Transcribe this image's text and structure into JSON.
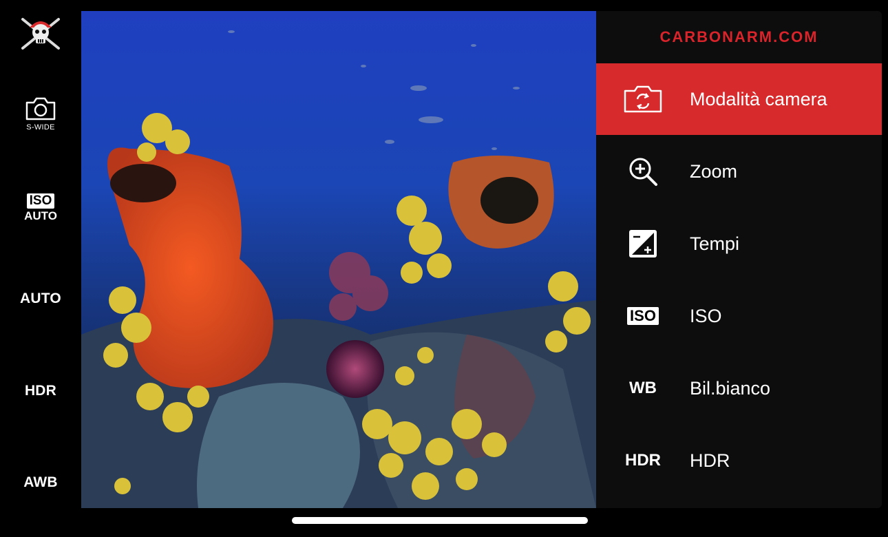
{
  "sidebar": {
    "camera_label": "S-WIDE",
    "iso_box": "ISO",
    "iso_value": "AUTO",
    "exposure": "AUTO",
    "hdr": "HDR",
    "wb": "AWB"
  },
  "menu": {
    "brand": "CARBONARM.COM",
    "items": [
      {
        "label": "Modalità camera",
        "icon": "camera-switch-icon"
      },
      {
        "label": "Zoom",
        "icon": "zoom-in-icon"
      },
      {
        "label": "Tempi",
        "icon": "exposure-icon"
      },
      {
        "label": "ISO",
        "icon": "ISO"
      },
      {
        "label": "Bil.bianco",
        "icon": "WB"
      },
      {
        "label": "HDR",
        "icon": "HDR"
      }
    ]
  },
  "colors": {
    "accent": "#d62a2c",
    "brand": "#d8242a",
    "panel": "#0d0d0e",
    "background": "#000000"
  }
}
